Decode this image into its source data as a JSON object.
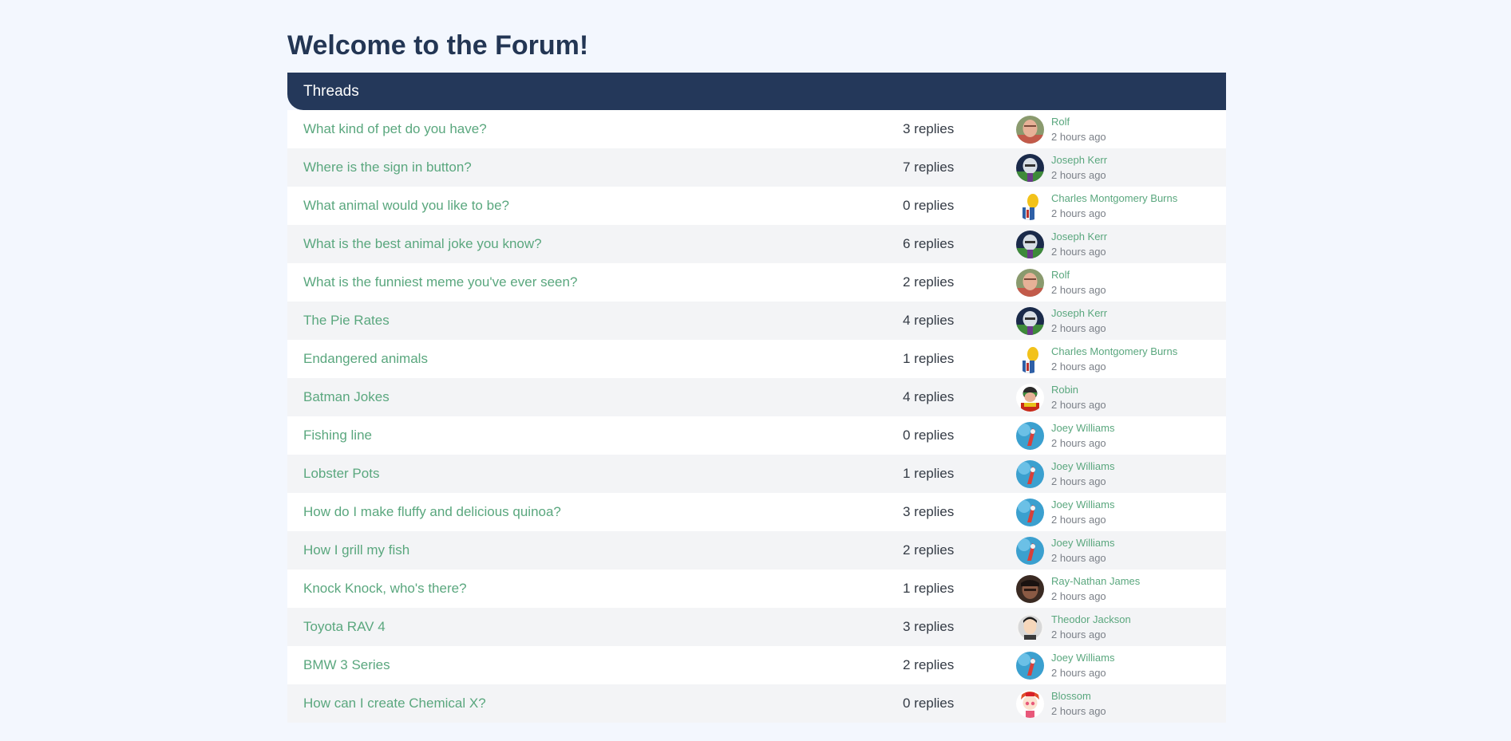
{
  "page": {
    "title": "Welcome to the Forum!",
    "section_heading": "Threads"
  },
  "colors": {
    "page_background": "#f3f7fe",
    "header_background": "#24385a",
    "link": "#5aa77e",
    "muted_text": "#7b8088"
  },
  "threads": [
    {
      "title": "What kind of pet do you have?",
      "replies": "3 replies",
      "author": "Rolf",
      "time": "2 hours ago",
      "avatar": "rolf"
    },
    {
      "title": "Where is the sign in button?",
      "replies": "7 replies",
      "author": "Joseph Kerr",
      "time": "2 hours ago",
      "avatar": "joseph"
    },
    {
      "title": "What animal would you like to be?",
      "replies": "0 replies",
      "author": "Charles Montgomery Burns",
      "time": "2 hours ago",
      "avatar": "burns"
    },
    {
      "title": "What is the best animal joke you know?",
      "replies": "6 replies",
      "author": "Joseph Kerr",
      "time": "2 hours ago",
      "avatar": "joseph"
    },
    {
      "title": "What is the funniest meme you've ever seen?",
      "replies": "2 replies",
      "author": "Rolf",
      "time": "2 hours ago",
      "avatar": "rolf"
    },
    {
      "title": "The Pie Rates",
      "replies": "4 replies",
      "author": "Joseph Kerr",
      "time": "2 hours ago",
      "avatar": "joseph"
    },
    {
      "title": "Endangered animals",
      "replies": "1 replies",
      "author": "Charles Montgomery Burns",
      "time": "2 hours ago",
      "avatar": "burns"
    },
    {
      "title": "Batman Jokes",
      "replies": "4 replies",
      "author": "Robin",
      "time": "2 hours ago",
      "avatar": "robin"
    },
    {
      "title": "Fishing line",
      "replies": "0 replies",
      "author": "Joey Williams",
      "time": "2 hours ago",
      "avatar": "joey"
    },
    {
      "title": "Lobster Pots",
      "replies": "1 replies",
      "author": "Joey Williams",
      "time": "2 hours ago",
      "avatar": "joey"
    },
    {
      "title": "How do I make fluffy and delicious quinoa?",
      "replies": "3 replies",
      "author": "Joey Williams",
      "time": "2 hours ago",
      "avatar": "joey"
    },
    {
      "title": "How I grill my fish",
      "replies": "2 replies",
      "author": "Joey Williams",
      "time": "2 hours ago",
      "avatar": "joey"
    },
    {
      "title": "Knock Knock, who's there?",
      "replies": "1 replies",
      "author": "Ray-Nathan James",
      "time": "2 hours ago",
      "avatar": "ray"
    },
    {
      "title": "Toyota RAV 4",
      "replies": "3 replies",
      "author": "Theodor Jackson",
      "time": "2 hours ago",
      "avatar": "theodor"
    },
    {
      "title": "BMW 3 Series",
      "replies": "2 replies",
      "author": "Joey Williams",
      "time": "2 hours ago",
      "avatar": "joey"
    },
    {
      "title": "How can I create Chemical X?",
      "replies": "0 replies",
      "author": "Blossom",
      "time": "2 hours ago",
      "avatar": "blossom"
    }
  ]
}
